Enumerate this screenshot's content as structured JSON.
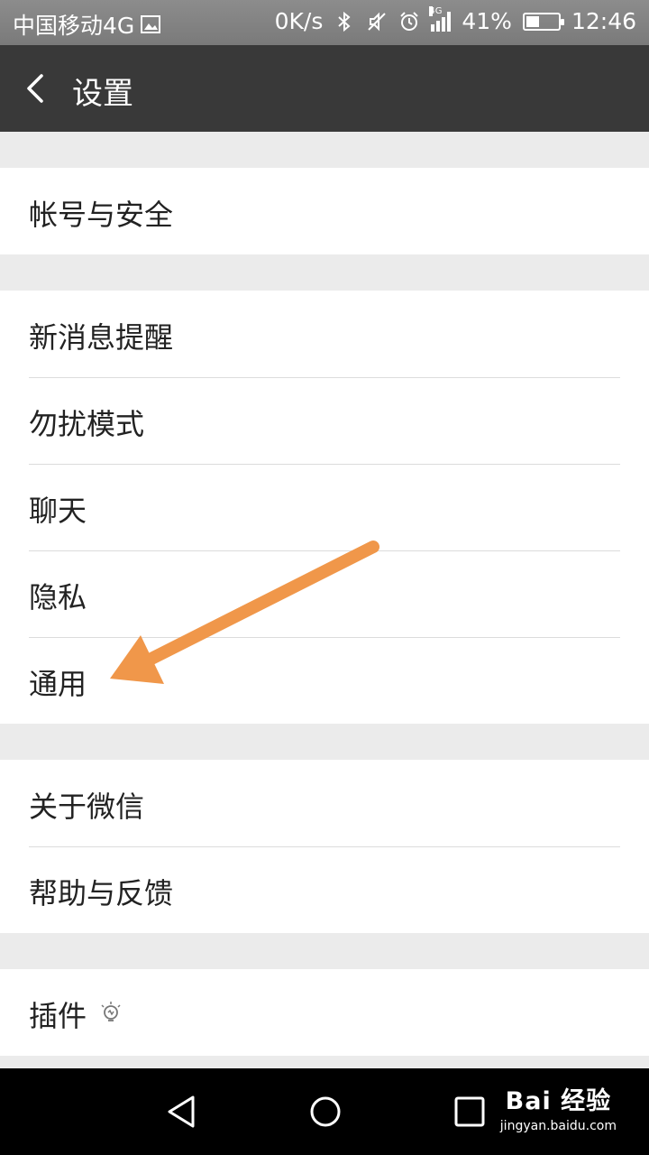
{
  "status_bar": {
    "carrier": "中国移动4G",
    "speed": "0K/s",
    "network_label": "4G",
    "battery_percent": "41%",
    "battery_level": 0.41,
    "time": "12:46",
    "icons": [
      "image-icon",
      "bluetooth-icon",
      "mute-icon",
      "alarm-icon",
      "signal-icon",
      "battery-icon"
    ]
  },
  "header": {
    "title": "设置",
    "back_icon": "back-chevron-icon"
  },
  "groups": [
    {
      "items": [
        {
          "label": "帐号与安全"
        }
      ]
    },
    {
      "items": [
        {
          "label": "新消息提醒"
        },
        {
          "label": "勿扰模式"
        },
        {
          "label": "聊天"
        },
        {
          "label": "隐私"
        },
        {
          "label": "通用"
        }
      ]
    },
    {
      "items": [
        {
          "label": "关于微信"
        },
        {
          "label": "帮助与反馈"
        }
      ]
    },
    {
      "items": [
        {
          "label": "插件",
          "icon": "lightbulb-icon"
        }
      ]
    }
  ],
  "annotation": {
    "color": "#f0974a",
    "points_to": "通用"
  },
  "nav_bar": {
    "icons": [
      "back-triangle-icon",
      "home-circle-icon",
      "recents-square-icon"
    ]
  },
  "watermark": {
    "main": "Bai 经验",
    "sub": "jingyan.baidu.com"
  },
  "colors": {
    "header_bg": "#393939",
    "page_bg": "#ebebeb",
    "row_bg": "#ffffff"
  }
}
